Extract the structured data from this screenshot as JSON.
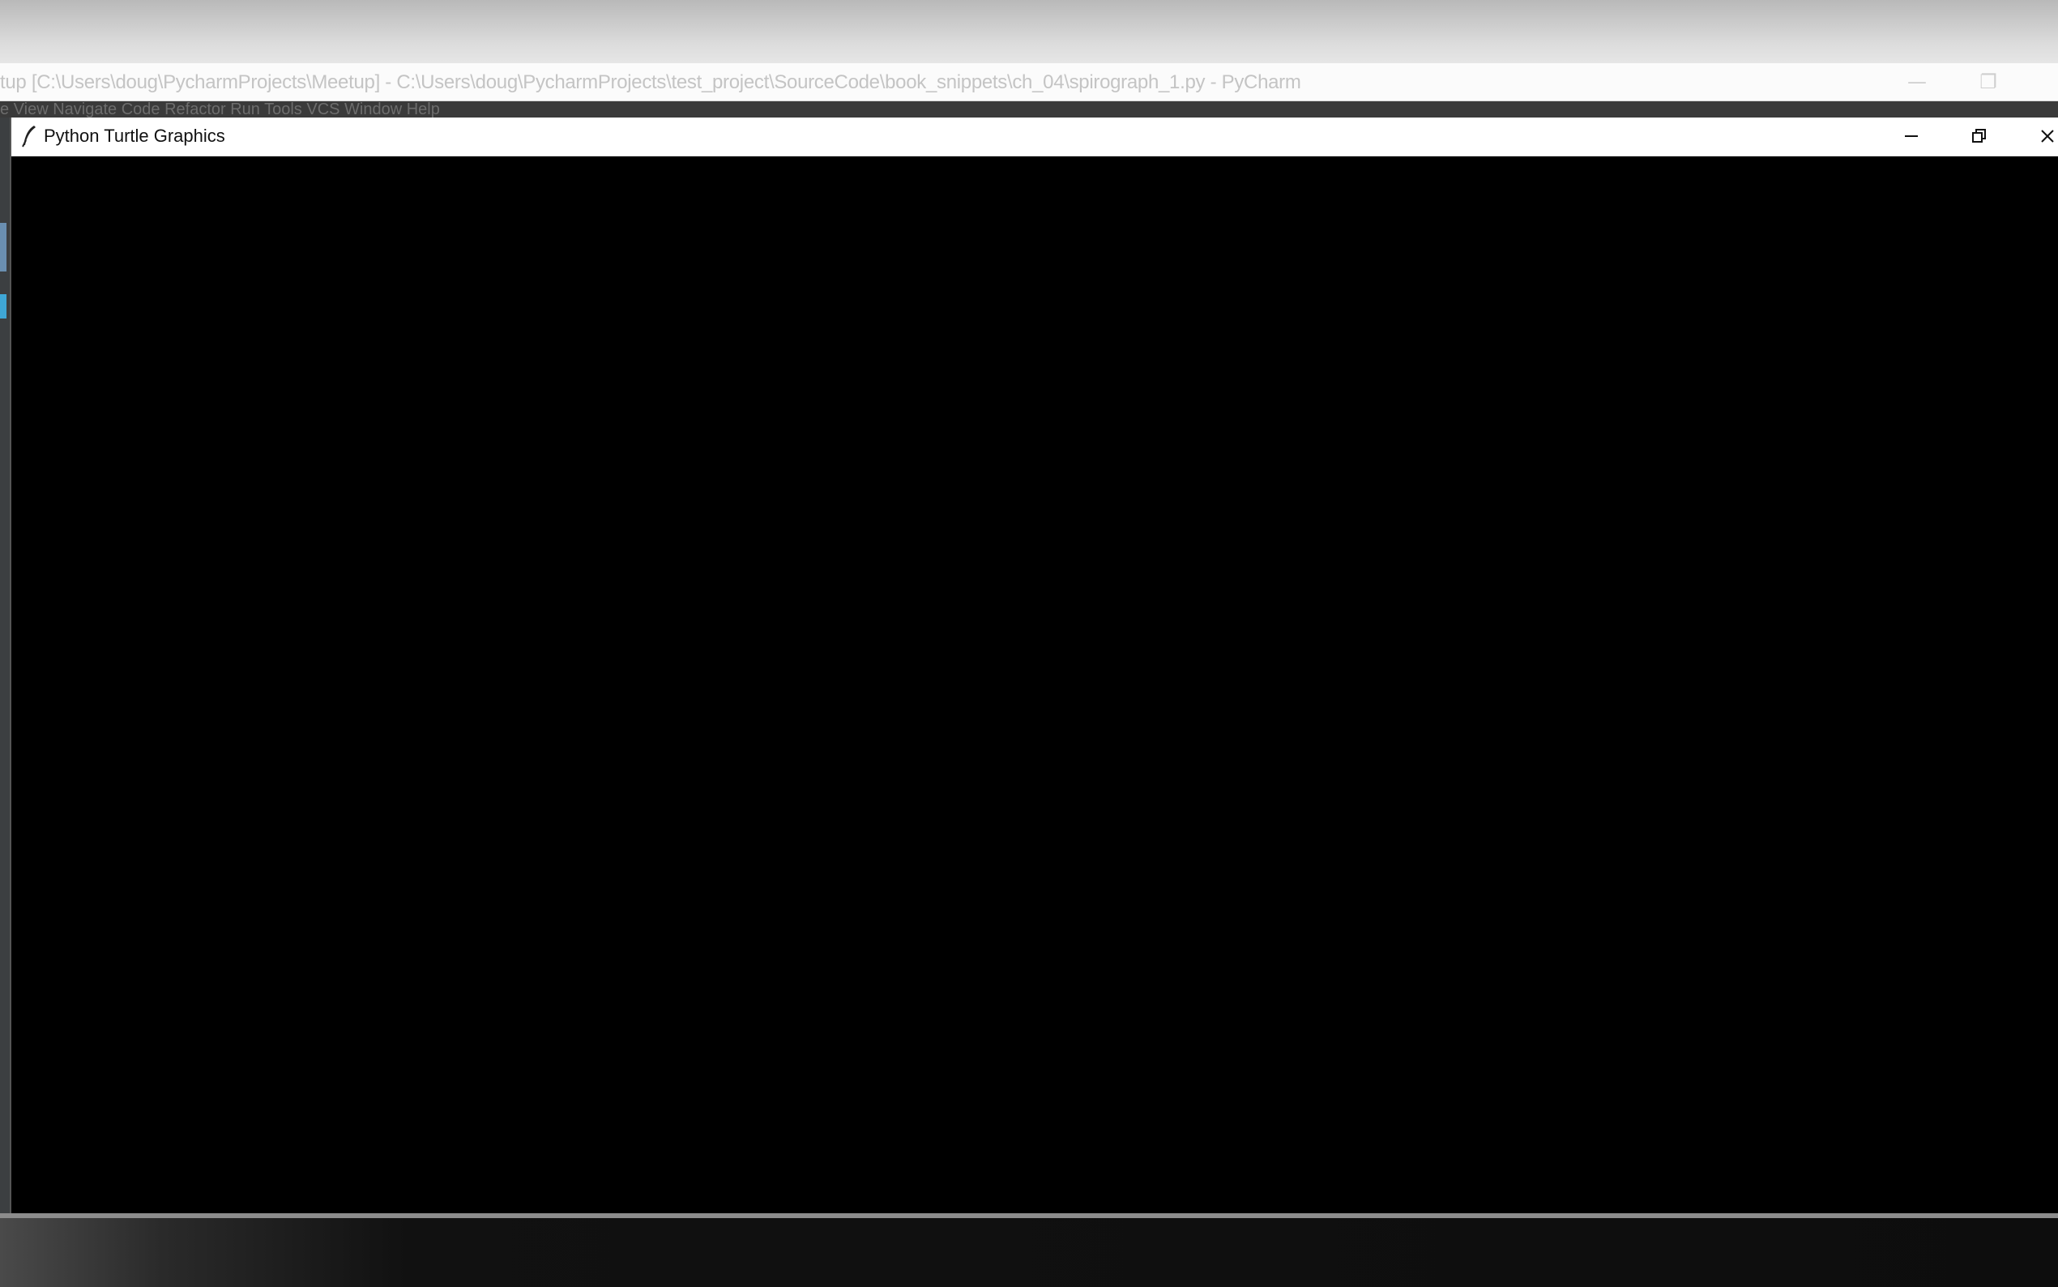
{
  "ide": {
    "title": "tup [C:\\Users\\doug\\PycharmProjects\\Meetup] - C:\\Users\\doug\\PycharmProjects\\test_project\\SourceCode\\book_snippets\\ch_04\\spirograph_1.py - PyCharm",
    "minimize_label": "—",
    "restore_label": "❐",
    "menu_text": "e  View  Navigate  Code  Refactor  Run  Tools  VCS  Window  Help"
  },
  "turtle": {
    "title": "Python Turtle Graphics",
    "icon": "feather-icon",
    "canvas_color": "#000000"
  }
}
